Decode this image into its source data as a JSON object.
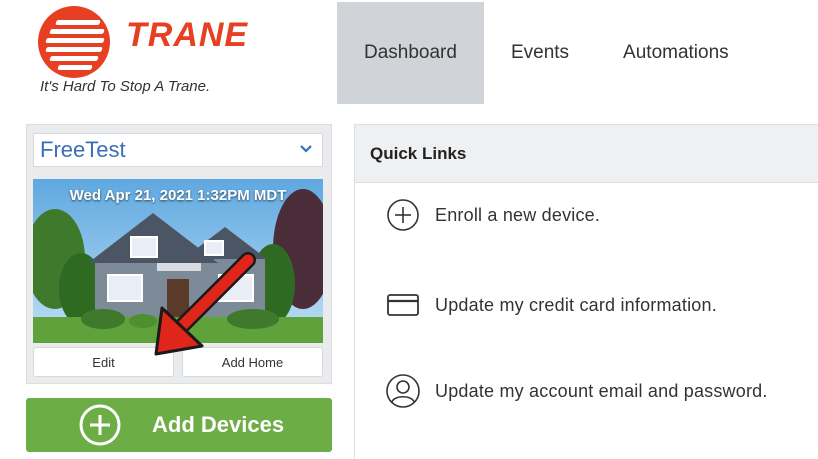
{
  "brand": {
    "name": "TRANE",
    "tagline": "It's Hard To Stop A Trane.",
    "color": "#e63f22"
  },
  "nav": {
    "tabs": [
      {
        "label": "Dashboard",
        "active": true
      },
      {
        "label": "Events",
        "active": false
      },
      {
        "label": "Automations",
        "active": false
      }
    ]
  },
  "home": {
    "selected": "FreeTest",
    "datetime": "Wed Apr 21, 2021 1:32PM MDT",
    "edit_label": "Edit",
    "add_home_label": "Add Home"
  },
  "add_devices": {
    "label": "Add Devices",
    "color": "#6cad45"
  },
  "quick_links": {
    "title": "Quick Links",
    "items": [
      {
        "label": "Enroll a new device.",
        "icon": "plus-circle-icon"
      },
      {
        "label": "Update my credit card information.",
        "icon": "credit-card-icon"
      },
      {
        "label": "Update my account email and password.",
        "icon": "user-circle-icon"
      }
    ]
  }
}
